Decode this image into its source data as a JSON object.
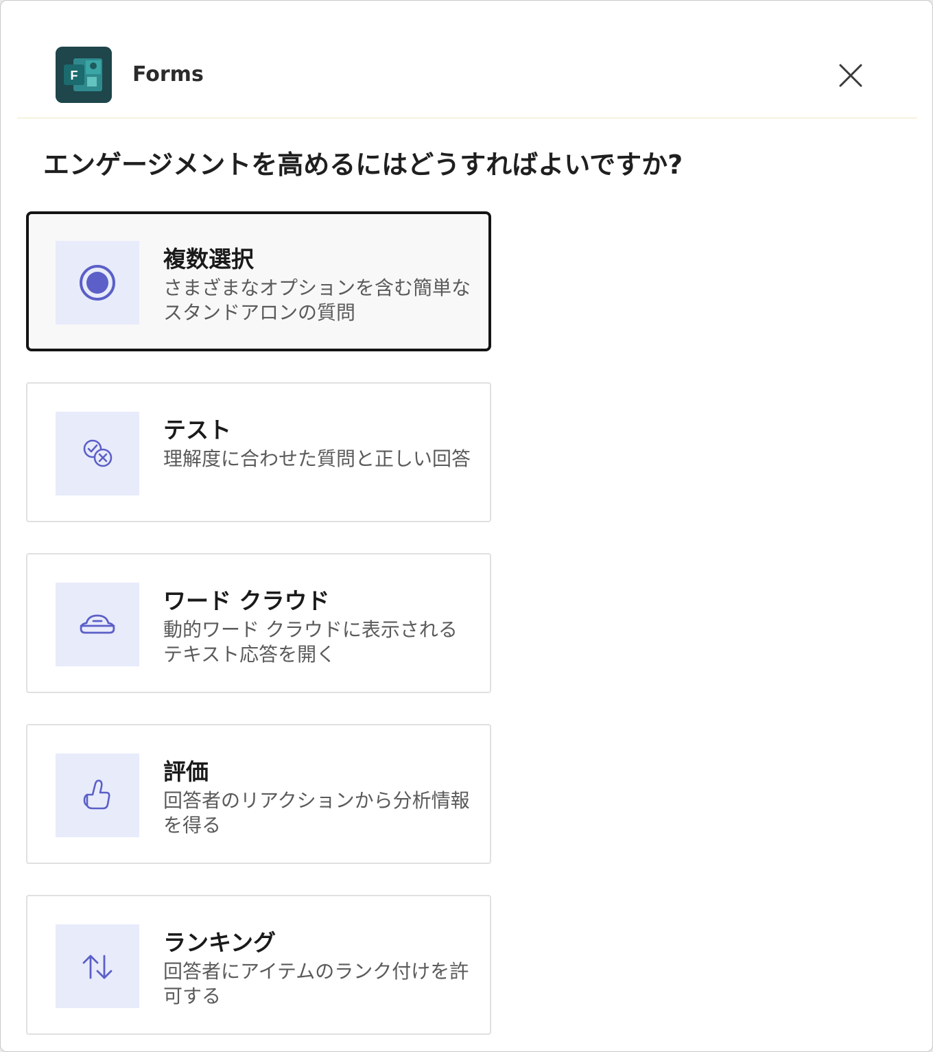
{
  "header": {
    "app_name": "Forms",
    "app_icon": "forms-app-icon",
    "close_icon": "close-icon"
  },
  "prompt": "エンゲージメントを高めるにはどうすればよいですか?",
  "colors": {
    "accent": "#5b5fc7",
    "icon_bg": "#e8ebfa",
    "selected_border": "#141414"
  },
  "options": [
    {
      "title": "複数選択",
      "description": "さまざまなオプションを含む簡単なスタンドアロンの質問",
      "icon": "radio-button-icon",
      "selected": true
    },
    {
      "title": "テスト",
      "description": "理解度に合わせた質問と正しい回答",
      "icon": "quiz-check-cross-icon",
      "selected": false
    },
    {
      "title": "ワード クラウド",
      "description": "動的ワード クラウドに表示されるテキスト応答を開く",
      "icon": "cloud-icon",
      "selected": false
    },
    {
      "title": "評価",
      "description": "回答者のリアクションから分析情報を得る",
      "icon": "thumbs-up-icon",
      "selected": false
    },
    {
      "title": "ランキング",
      "description": "回答者にアイテムのランク付けを許可する",
      "icon": "arrow-sort-icon",
      "selected": false
    }
  ]
}
